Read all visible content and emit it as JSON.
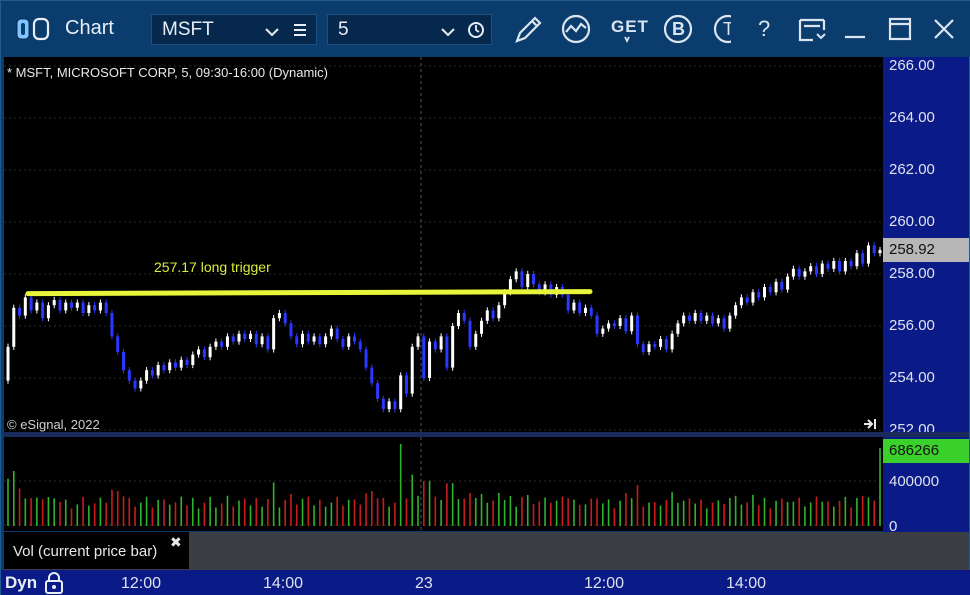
{
  "window": {
    "title": "Chart",
    "symbol": "MSFT",
    "interval": "5"
  },
  "toolbar": {
    "icons": [
      "link-icon",
      "pencil-icon",
      "study-icon",
      "get-icon",
      "b-icon",
      "t-icon",
      "help-icon",
      "save-icon",
      "minimize-icon",
      "maximize-icon",
      "close-icon"
    ],
    "get_label": "GET",
    "b_label": "B",
    "t_label": "T",
    "help_label": "?"
  },
  "chart": {
    "header": "* MSFT, MICROSOFT CORP, 5, 09:30-16:00 (Dynamic)",
    "copyright": "© eSignal, 2022",
    "annotation": "257.17 long trigger",
    "trigger_price": 257.17,
    "last_price": "258.92",
    "y_ticks": [
      "266.00",
      "264.00",
      "262.00",
      "260.00",
      "258.00",
      "256.00",
      "254.00",
      "252.00"
    ],
    "ylim": [
      252,
      266
    ],
    "colors": {
      "up": "#ffffff",
      "down": "#2a38ff",
      "trigger": "#e7f53a",
      "annotation": "#d8ee39",
      "vol_up": "#2fb32f",
      "vol_down": "#c81c1c",
      "last_price_bg": "#b7b7b7"
    }
  },
  "volume": {
    "label": "Vol (current price bar)",
    "close_label": "✖",
    "last_value": "686266",
    "y_ticks": [
      "400000",
      "0"
    ]
  },
  "xaxis": {
    "left_label": "Dyn",
    "ticks": [
      "12:00",
      "14:00",
      "23",
      "12:00",
      "14:00"
    ]
  },
  "chart_data": {
    "type": "candlestick",
    "title": "* MSFT, MICROSOFT CORP, 5, 09:30-16:00 (Dynamic)",
    "ylim": [
      252,
      266
    ],
    "candles": [
      {
        "o": 253.9,
        "c": 255.2
      },
      {
        "o": 255.2,
        "c": 256.7
      },
      {
        "o": 256.7,
        "c": 256.4
      },
      {
        "o": 256.4,
        "c": 257.1
      },
      {
        "o": 257.1,
        "c": 256.6
      },
      {
        "o": 256.6,
        "c": 256.9
      },
      {
        "o": 256.9,
        "c": 256.3
      },
      {
        "o": 256.3,
        "c": 256.8
      },
      {
        "o": 256.8,
        "c": 257.0
      },
      {
        "o": 257.0,
        "c": 256.6
      },
      {
        "o": 256.6,
        "c": 256.9
      },
      {
        "o": 256.9,
        "c": 256.7
      },
      {
        "o": 256.7,
        "c": 256.9
      },
      {
        "o": 256.9,
        "c": 256.5
      },
      {
        "o": 256.5,
        "c": 256.8
      },
      {
        "o": 256.8,
        "c": 256.6
      },
      {
        "o": 256.6,
        "c": 256.9
      },
      {
        "o": 256.9,
        "c": 256.5
      },
      {
        "o": 256.5,
        "c": 255.6
      },
      {
        "o": 255.6,
        "c": 255.0
      },
      {
        "o": 255.0,
        "c": 254.3
      },
      {
        "o": 254.3,
        "c": 253.9
      },
      {
        "o": 253.9,
        "c": 253.6
      },
      {
        "o": 253.6,
        "c": 253.9
      },
      {
        "o": 253.9,
        "c": 254.3
      },
      {
        "o": 254.3,
        "c": 254.1
      },
      {
        "o": 254.1,
        "c": 254.5
      },
      {
        "o": 254.5,
        "c": 254.3
      },
      {
        "o": 254.3,
        "c": 254.6
      },
      {
        "o": 254.6,
        "c": 254.4
      },
      {
        "o": 254.4,
        "c": 254.7
      },
      {
        "o": 254.7,
        "c": 254.5
      },
      {
        "o": 254.5,
        "c": 254.9
      },
      {
        "o": 254.9,
        "c": 255.1
      },
      {
        "o": 255.1,
        "c": 254.8
      },
      {
        "o": 254.8,
        "c": 255.2
      },
      {
        "o": 255.2,
        "c": 255.4
      },
      {
        "o": 255.4,
        "c": 255.2
      },
      {
        "o": 255.2,
        "c": 255.6
      },
      {
        "o": 255.6,
        "c": 255.4
      },
      {
        "o": 255.4,
        "c": 255.7
      },
      {
        "o": 255.7,
        "c": 255.5
      },
      {
        "o": 255.5,
        "c": 255.7
      },
      {
        "o": 255.7,
        "c": 255.3
      },
      {
        "o": 255.3,
        "c": 255.6
      },
      {
        "o": 255.6,
        "c": 255.1
      },
      {
        "o": 255.1,
        "c": 256.3
      },
      {
        "o": 256.3,
        "c": 256.5
      },
      {
        "o": 256.5,
        "c": 256.1
      },
      {
        "o": 256.1,
        "c": 255.6
      },
      {
        "o": 255.6,
        "c": 255.3
      },
      {
        "o": 255.3,
        "c": 255.7
      },
      {
        "o": 255.7,
        "c": 255.4
      },
      {
        "o": 255.4,
        "c": 255.6
      },
      {
        "o": 255.6,
        "c": 255.3
      },
      {
        "o": 255.3,
        "c": 255.6
      },
      {
        "o": 255.6,
        "c": 255.9
      },
      {
        "o": 255.9,
        "c": 255.5
      },
      {
        "o": 255.5,
        "c": 255.2
      },
      {
        "o": 255.2,
        "c": 255.6
      },
      {
        "o": 255.6,
        "c": 255.4
      },
      {
        "o": 255.4,
        "c": 255.1
      },
      {
        "o": 255.1,
        "c": 254.4
      },
      {
        "o": 254.4,
        "c": 253.8
      },
      {
        "o": 253.8,
        "c": 253.2
      },
      {
        "o": 253.2,
        "c": 252.8
      },
      {
        "o": 252.8,
        "c": 253.1
      },
      {
        "o": 253.1,
        "c": 252.8
      },
      {
        "o": 252.8,
        "c": 254.1
      },
      {
        "o": 254.1,
        "c": 253.4
      },
      {
        "o": 253.4,
        "c": 255.2
      },
      {
        "o": 255.2,
        "c": 255.6
      },
      {
        "o": 255.6,
        "c": 254.0
      },
      {
        "o": 254.0,
        "c": 255.4
      },
      {
        "o": 255.4,
        "c": 255.1
      },
      {
        "o": 255.1,
        "c": 255.6
      },
      {
        "o": 255.6,
        "c": 254.4
      },
      {
        "o": 254.4,
        "c": 256.0
      },
      {
        "o": 256.0,
        "c": 256.5
      },
      {
        "o": 256.5,
        "c": 256.2
      },
      {
        "o": 256.2,
        "c": 255.2
      },
      {
        "o": 255.2,
        "c": 255.7
      },
      {
        "o": 255.7,
        "c": 256.2
      },
      {
        "o": 256.2,
        "c": 256.6
      },
      {
        "o": 256.6,
        "c": 256.3
      },
      {
        "o": 256.3,
        "c": 256.8
      },
      {
        "o": 256.8,
        "c": 257.3
      },
      {
        "o": 257.3,
        "c": 257.8
      },
      {
        "o": 257.8,
        "c": 258.1
      },
      {
        "o": 258.1,
        "c": 257.5
      },
      {
        "o": 257.5,
        "c": 258.0
      },
      {
        "o": 258.0,
        "c": 257.6
      },
      {
        "o": 257.6,
        "c": 257.3
      },
      {
        "o": 257.3,
        "c": 257.6
      },
      {
        "o": 257.6,
        "c": 257.2
      },
      {
        "o": 257.2,
        "c": 257.5
      },
      {
        "o": 257.5,
        "c": 257.2
      },
      {
        "o": 257.2,
        "c": 256.6
      },
      {
        "o": 256.6,
        "c": 256.9
      },
      {
        "o": 256.9,
        "c": 256.5
      },
      {
        "o": 256.5,
        "c": 256.7
      },
      {
        "o": 256.7,
        "c": 256.4
      },
      {
        "o": 256.4,
        "c": 255.7
      },
      {
        "o": 255.7,
        "c": 255.9
      },
      {
        "o": 255.9,
        "c": 256.1
      },
      {
        "o": 256.1,
        "c": 256.0
      },
      {
        "o": 256.0,
        "c": 256.3
      },
      {
        "o": 256.3,
        "c": 255.8
      },
      {
        "o": 255.8,
        "c": 256.4
      },
      {
        "o": 256.4,
        "c": 255.3
      },
      {
        "o": 255.3,
        "c": 255.0
      },
      {
        "o": 255.0,
        "c": 255.3
      },
      {
        "o": 255.3,
        "c": 255.2
      },
      {
        "o": 255.2,
        "c": 255.5
      },
      {
        "o": 255.5,
        "c": 255.1
      },
      {
        "o": 255.1,
        "c": 255.7
      },
      {
        "o": 255.7,
        "c": 256.1
      },
      {
        "o": 256.1,
        "c": 256.4
      },
      {
        "o": 256.4,
        "c": 256.2
      },
      {
        "o": 256.2,
        "c": 256.5
      },
      {
        "o": 256.5,
        "c": 256.2
      },
      {
        "o": 256.2,
        "c": 256.4
      },
      {
        "o": 256.4,
        "c": 256.1
      },
      {
        "o": 256.1,
        "c": 256.3
      },
      {
        "o": 256.3,
        "c": 255.9
      },
      {
        "o": 255.9,
        "c": 256.4
      },
      {
        "o": 256.4,
        "c": 256.8
      },
      {
        "o": 256.8,
        "c": 257.1
      },
      {
        "o": 257.1,
        "c": 256.9
      },
      {
        "o": 256.9,
        "c": 257.3
      },
      {
        "o": 257.3,
        "c": 257.1
      },
      {
        "o": 257.1,
        "c": 257.5
      },
      {
        "o": 257.5,
        "c": 257.3
      },
      {
        "o": 257.3,
        "c": 257.7
      },
      {
        "o": 257.7,
        "c": 257.4
      },
      {
        "o": 257.4,
        "c": 257.9
      },
      {
        "o": 257.9,
        "c": 258.2
      },
      {
        "o": 258.2,
        "c": 257.9
      },
      {
        "o": 257.9,
        "c": 258.1
      },
      {
        "o": 258.1,
        "c": 258.3
      },
      {
        "o": 258.3,
        "c": 258.0
      },
      {
        "o": 258.0,
        "c": 258.4
      },
      {
        "o": 258.4,
        "c": 258.2
      },
      {
        "o": 258.2,
        "c": 258.5
      },
      {
        "o": 258.5,
        "c": 258.1
      },
      {
        "o": 258.1,
        "c": 258.5
      },
      {
        "o": 258.5,
        "c": 258.3
      },
      {
        "o": 258.3,
        "c": 258.8
      },
      {
        "o": 258.8,
        "c": 258.4
      },
      {
        "o": 258.4,
        "c": 259.1
      },
      {
        "o": 259.1,
        "c": 258.8
      },
      {
        "o": 258.8,
        "c": 258.92
      }
    ],
    "volume_max": 686266
  }
}
